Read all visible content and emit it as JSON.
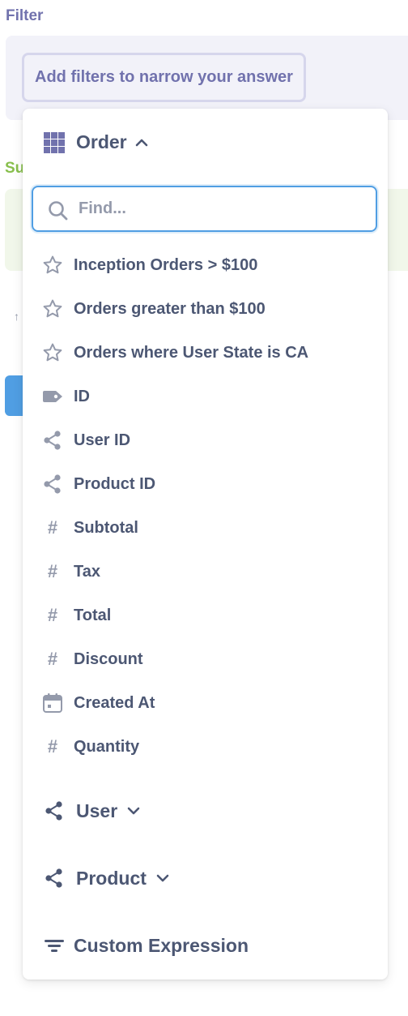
{
  "page": {
    "filter_label": "Filter",
    "add_filter_button": "Add filters to narrow your answer",
    "summarize_label": "Su",
    "arrow_glyph": "↑"
  },
  "popover": {
    "table_name": "Order",
    "search": {
      "placeholder": "Find...",
      "value": ""
    },
    "items": [
      {
        "label": "Inception Orders > $100",
        "icon": "star-icon"
      },
      {
        "label": "Orders greater than $100",
        "icon": "star-icon"
      },
      {
        "label": "Orders where User State is CA",
        "icon": "star-icon"
      },
      {
        "label": "ID",
        "icon": "label-icon"
      },
      {
        "label": "User ID",
        "icon": "connections-icon"
      },
      {
        "label": "Product ID",
        "icon": "connections-icon"
      },
      {
        "label": "Subtotal",
        "icon": "number-icon",
        "glyph": "#"
      },
      {
        "label": "Tax",
        "icon": "number-icon",
        "glyph": "#"
      },
      {
        "label": "Total",
        "icon": "number-icon",
        "glyph": "#"
      },
      {
        "label": "Discount",
        "icon": "number-icon",
        "glyph": "#"
      },
      {
        "label": "Created At",
        "icon": "calendar-icon"
      },
      {
        "label": "Quantity",
        "icon": "number-icon",
        "glyph": "#"
      }
    ],
    "sections": [
      {
        "label": "User",
        "icon": "connections-icon",
        "expanded": false
      },
      {
        "label": "Product",
        "icon": "connections-icon",
        "expanded": false
      }
    ],
    "custom_expression": "Custom Expression"
  },
  "colors": {
    "brand": "#509ee3",
    "filter_accent": "#7172ad",
    "summarize_accent": "#88bf4d",
    "text_dark": "#4c5773",
    "text_light": "#949aab"
  }
}
